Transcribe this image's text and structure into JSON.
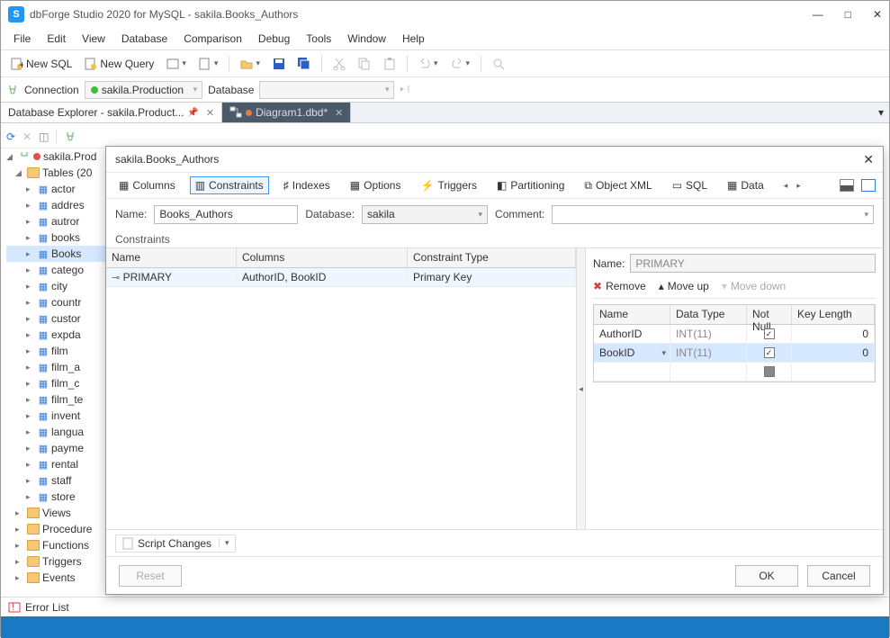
{
  "window": {
    "logo_letter": "S",
    "title": "dbForge Studio 2020 for MySQL - sakila.Books_Authors"
  },
  "menu": [
    "File",
    "Edit",
    "View",
    "Database",
    "Comparison",
    "Debug",
    "Tools",
    "Window",
    "Help"
  ],
  "toolbar": {
    "new_sql": "New SQL",
    "new_query": "New Query"
  },
  "connbar": {
    "connection_label": "Connection",
    "connection_value": "sakila.Production",
    "database_label": "Database",
    "database_value": ""
  },
  "doctabs": {
    "explorer": "Database Explorer - sakila.Product...",
    "diagram": "Diagram1.dbd*"
  },
  "tree": {
    "root": "sakila.Prod",
    "tables_label": "Tables (20",
    "items": [
      "actor",
      "addres",
      "autror",
      "books",
      "Books",
      "catego",
      "city",
      "countr",
      "custor",
      "expda",
      "film",
      "film_a",
      "film_c",
      "film_te",
      "invent",
      "langua",
      "payme",
      "rental",
      "staff",
      "store"
    ],
    "folders": [
      "Views",
      "Procedure",
      "Functions",
      "Triggers",
      "Events"
    ]
  },
  "dialog": {
    "title": "sakila.Books_Authors",
    "tabs": {
      "columns": "Columns",
      "constraints": "Constraints",
      "indexes": "Indexes",
      "options": "Options",
      "triggers": "Triggers",
      "partitioning": "Partitioning",
      "objectxml": "Object XML",
      "sql": "SQL",
      "data": "Data"
    },
    "form": {
      "name_label": "Name:",
      "name_value": "Books_Authors",
      "database_label": "Database:",
      "database_value": "sakila",
      "comment_label": "Comment:",
      "comment_value": ""
    },
    "section": "Constraints",
    "grid": {
      "headers": {
        "name": "Name",
        "columns": "Columns",
        "type": "Constraint Type"
      },
      "rows": [
        {
          "name": "PRIMARY",
          "columns": "AuthorID, BookID",
          "type": "Primary Key"
        }
      ]
    },
    "detail": {
      "name_label": "Name:",
      "name_value": "PRIMARY",
      "remove": "Remove",
      "moveup": "Move up",
      "movedown": "Move down",
      "headers": {
        "name": "Name",
        "datatype": "Data Type",
        "notnull": "Not Null",
        "keylen": "Key Length"
      },
      "rows": [
        {
          "name": "AuthorID",
          "datatype": "INT(11)",
          "notnull": true,
          "keylen": "0"
        },
        {
          "name": "BookID",
          "datatype": "INT(11)",
          "notnull": true,
          "keylen": "0"
        }
      ]
    },
    "script_changes": "Script Changes",
    "reset": "Reset",
    "ok": "OK",
    "cancel": "Cancel"
  },
  "errorbar": "Error List"
}
